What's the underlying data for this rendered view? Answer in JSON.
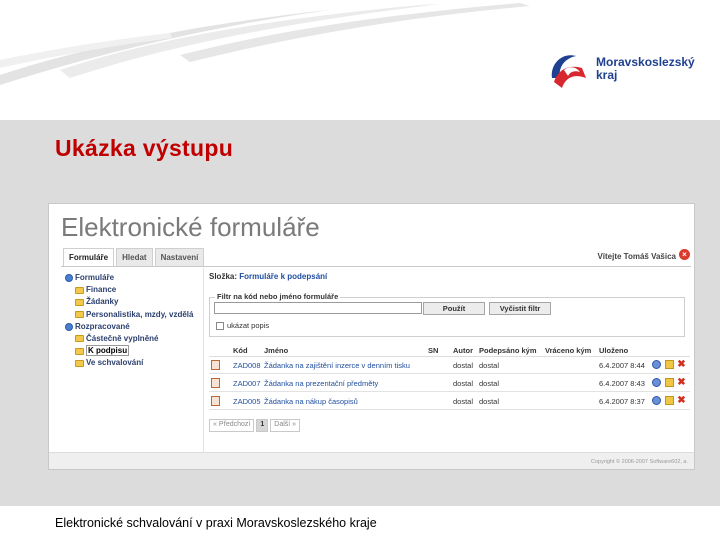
{
  "slide": {
    "title": "Ukázka výstupu",
    "footer": "Elektronické schvalování v praxi  Moravskoslezského kraje",
    "logo_line1": "Moravskoslezský",
    "logo_line2": "kraj"
  },
  "app": {
    "title": "Elektronické formuláře",
    "tabs": [
      {
        "label": "Formuláře"
      },
      {
        "label": "Hledat"
      },
      {
        "label": "Nastavení"
      }
    ],
    "welcome": "Vítejte Tomáš Vašica",
    "tree": [
      {
        "label": "Formuláře"
      },
      {
        "label": "Finance"
      },
      {
        "label": "Žádanky"
      },
      {
        "label": "Personalistika, mzdy, vzdělá"
      },
      {
        "label": "Rozpracované"
      },
      {
        "label": "Částečně vyplněné"
      },
      {
        "label": "K podpisu"
      },
      {
        "label": "Ve schvalování"
      }
    ],
    "folder_label": "Složka:",
    "folder_name": "Formuláře k podepsání",
    "filter_legend": "Filtr na kód nebo jméno formuláře",
    "filter_value": "",
    "apply_button": "Použít",
    "clear_button": "Vyčistit filtr",
    "show_desc": "ukázat popis",
    "columns": [
      "Kód",
      "Jméno",
      "SN",
      "Autor",
      "Podepsáno kým",
      "Vráceno kým",
      "Uloženo"
    ],
    "rows": [
      {
        "code": "ZAD008",
        "name": "Žádanka na zajištění inzerce v denním tisku",
        "sn": "",
        "author": "dostal",
        "signed": "dostal",
        "returned": "",
        "saved": "6.4.2007 8:44"
      },
      {
        "code": "ZAD007",
        "name": "Žádanka na prezentační předměty",
        "sn": "",
        "author": "dostal",
        "signed": "dostal",
        "returned": "",
        "saved": "6.4.2007 8:43"
      },
      {
        "code": "ZAD005",
        "name": "Žádanka na nákup časopisů",
        "sn": "",
        "author": "dostal",
        "signed": "dostal",
        "returned": "",
        "saved": "6.4.2007 8:37"
      }
    ],
    "pager": {
      "prev": "« Předchozí",
      "page": "1",
      "next": "Další »"
    },
    "copyright": "Copyright © 2006-2007 Software602, a."
  },
  "colors": {
    "title_red": "#c00000",
    "link_blue": "#1f4e9e",
    "delete_red": "#d12f20"
  }
}
